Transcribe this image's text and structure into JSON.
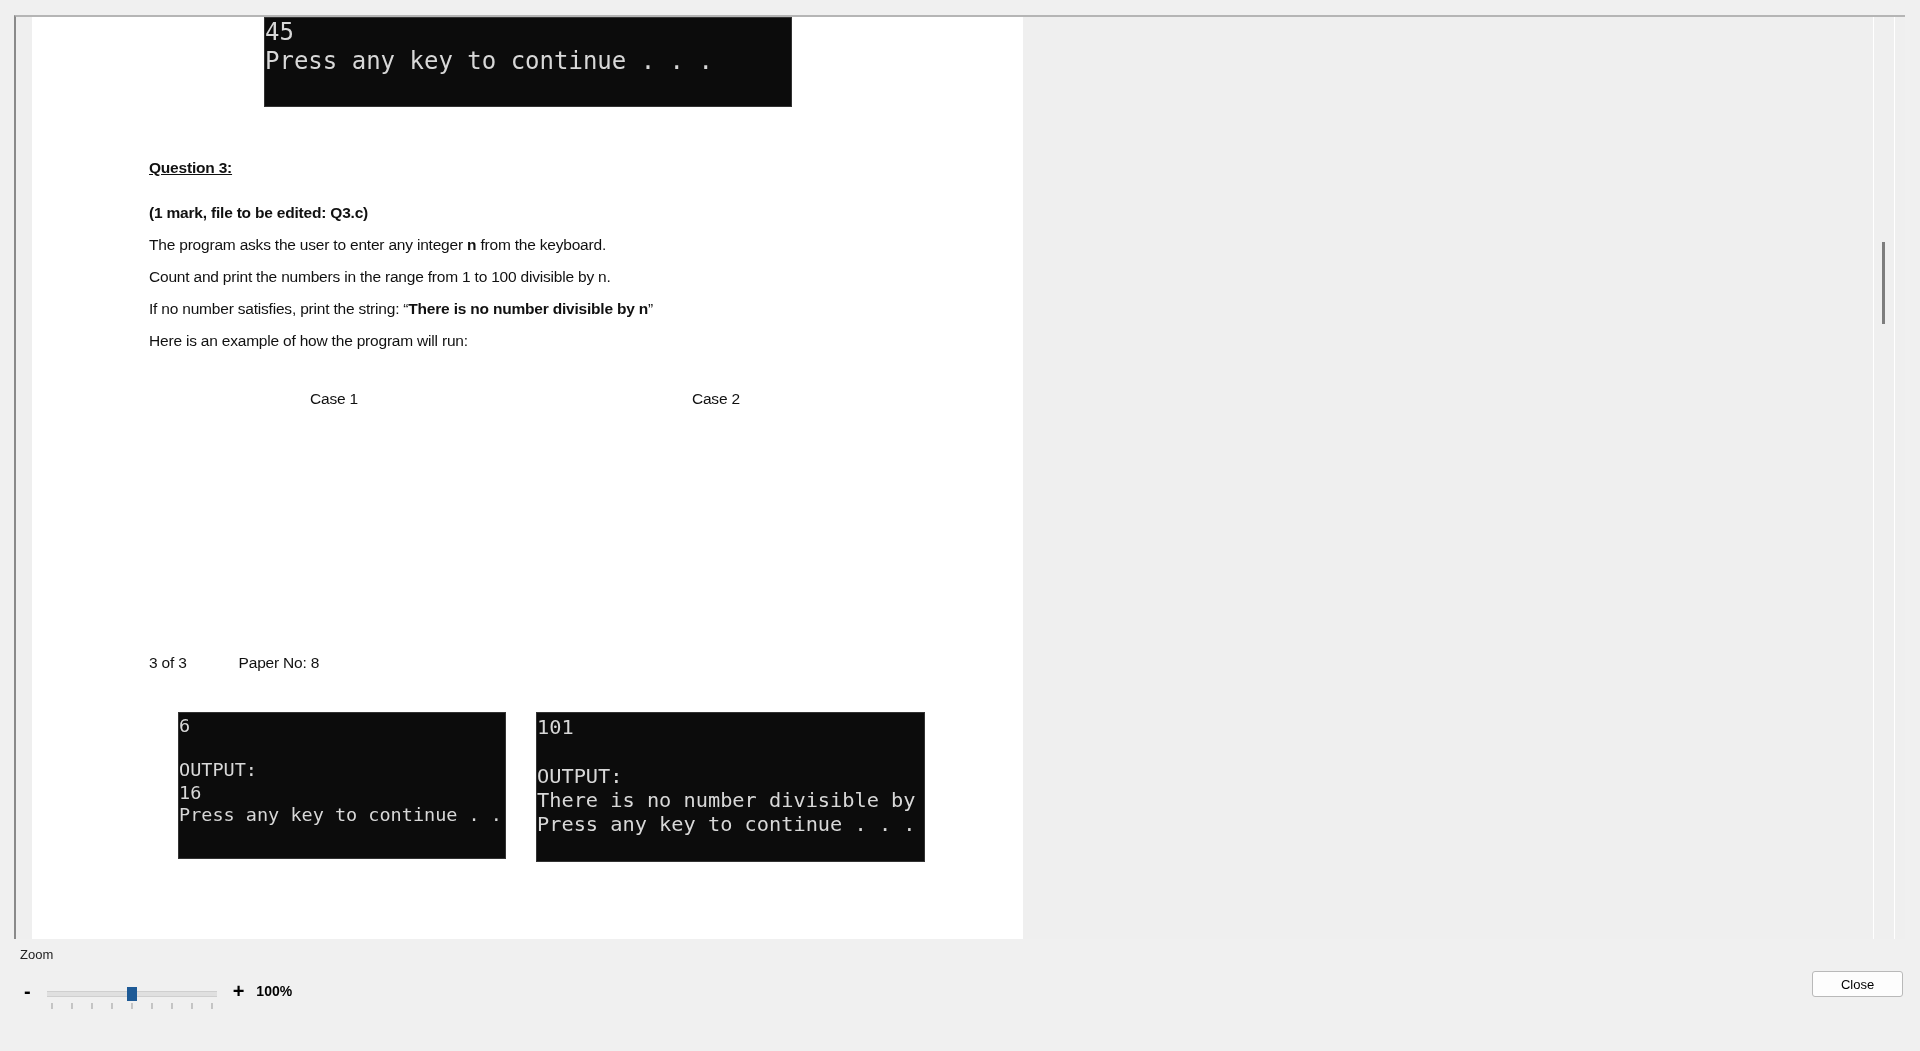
{
  "document": {
    "top_terminal": {
      "blocks": [
        [
          "45",
          "Press any key to continue . . ."
        ]
      ]
    },
    "question_title": "Question 3:",
    "subtitle": "(1 mark, file to be edited: Q3.c)",
    "paragraphs": [
      "The program asks the user to enter any integer **n** from the keyboard.",
      "Count and print the numbers in the range from 1 to 100 divisible by n.",
      "If no number satisfies, print the string: “**There is no number divisible by n**”",
      "Here is an example of how the program will run:"
    ],
    "cases": [
      "Case 1",
      "Case 2"
    ],
    "footer": {
      "page": "3 of 3",
      "paper": "Paper No: 8"
    },
    "terminals": [
      {
        "blocks": [
          [
            "6"
          ],
          [
            "OUTPUT:",
            "16",
            "Press any key to continue . ."
          ]
        ]
      },
      {
        "blocks": [
          [
            "101"
          ],
          [
            "OUTPUT:",
            "There is no number divisible by",
            "Press any key to continue . . ."
          ]
        ]
      }
    ]
  },
  "zoom": {
    "label": "Zoom",
    "minus": "-",
    "plus": "+",
    "value": "100%",
    "level": 0.5
  },
  "close_button": "Close"
}
